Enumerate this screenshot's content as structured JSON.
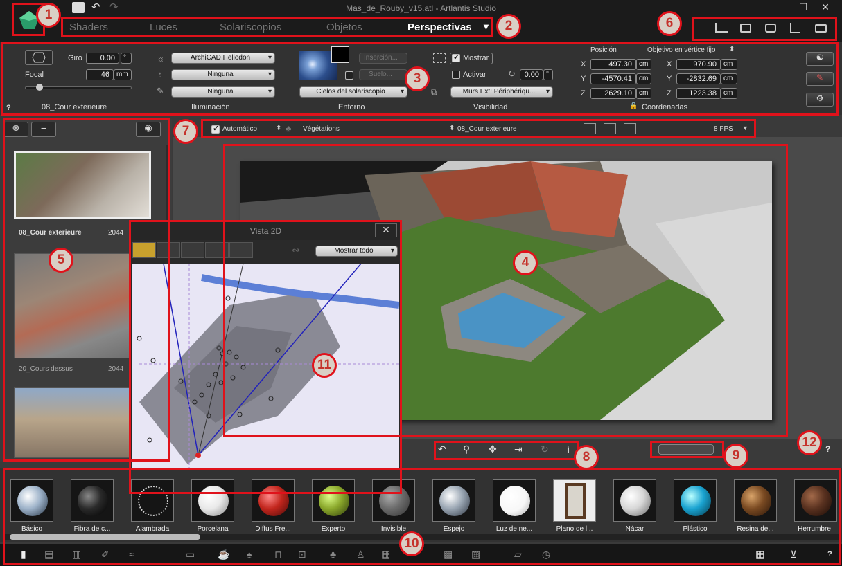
{
  "window": {
    "title": "Mas_de_Rouby_v15.atl - Artlantis Studio",
    "controls": [
      "—",
      "☐",
      "✕"
    ]
  },
  "tabs": [
    {
      "label": "Shaders"
    },
    {
      "label": "Luces"
    },
    {
      "label": "Solariscopios"
    },
    {
      "label": "Objetos"
    },
    {
      "label": "Perspectivas",
      "active": true
    }
  ],
  "inspector": {
    "giro_label": "Giro",
    "giro_value": "0.00",
    "giro_unit": "°",
    "focal_label": "Focal",
    "focal_value": "46",
    "focal_unit": "mm",
    "view_name": "08_Cour exterieure",
    "help": "?",
    "illumination": {
      "heliodon": "ArchiCAD Heliodon",
      "light1": "Ninguna",
      "light2": "Ninguna",
      "label": "Iluminación"
    },
    "environment": {
      "insertion": "Inserción...",
      "ground": "Suelo...",
      "sky": "Cielos del solariscopio",
      "label": "Entorno"
    },
    "visibility": {
      "mostrar": "Mostrar",
      "activar": "Activar",
      "angle": "0.00",
      "angle_unit": "°",
      "layer": "Murs Ext: Périphériqu...",
      "label": "Visibilidad"
    },
    "coords": {
      "position_label": "Posición",
      "target_label": "Objetivo en vértice fijo",
      "pos": {
        "x": "497.30",
        "y": "-4570.41",
        "z": "2629.10"
      },
      "target": {
        "x": "970.90",
        "y": "-2832.69",
        "z": "1223.38"
      },
      "unit": "cm",
      "label": "Coordenadas",
      "axis_x": "X",
      "axis_y": "Y",
      "axis_z": "Z"
    }
  },
  "viewbar": {
    "auto_label": "Automático",
    "veg_label": "Végétations",
    "view": "08_Cour exterieure",
    "fps": "8 FPS"
  },
  "views_list": [
    {
      "name": "08_Cour exterieure",
      "num": "2044"
    },
    {
      "name": "20_Cours dessus",
      "num": "2044"
    }
  ],
  "vista2d": {
    "title": "Vista 2D",
    "close": "✕",
    "filter": "Mostrar todo",
    "help": "?"
  },
  "materials": [
    {
      "name": "Básico",
      "color": "#9db2c9"
    },
    {
      "name": "Fibra de c...",
      "color": "#2a2a2a"
    },
    {
      "name": "Alambrada",
      "color": "#b9b9b9"
    },
    {
      "name": "Porcelana",
      "color": "#e9e9e9"
    },
    {
      "name": "Diffus Fre...",
      "color": "#c2261d"
    },
    {
      "name": "Experto",
      "color": "#8aa72b"
    },
    {
      "name": "Invisible",
      "color": "#6b6b6b"
    },
    {
      "name": "Espejo",
      "color": "#9aa6b3"
    },
    {
      "name": "Luz de ne...",
      "color": "#f7f7f7"
    },
    {
      "name": "Plano de l...",
      "color": "#d9d5cc"
    },
    {
      "name": "Nácar",
      "color": "#d7d7d7"
    },
    {
      "name": "Plástico",
      "color": "#1aa3d1"
    },
    {
      "name": "Resina de...",
      "color": "#7a4a22"
    },
    {
      "name": "Herrumbre",
      "color": "#5a3220"
    }
  ],
  "badges": [
    "1",
    "2",
    "3",
    "4",
    "5",
    "6",
    "7",
    "8",
    "9",
    "10",
    "11",
    "12"
  ],
  "help": "?"
}
